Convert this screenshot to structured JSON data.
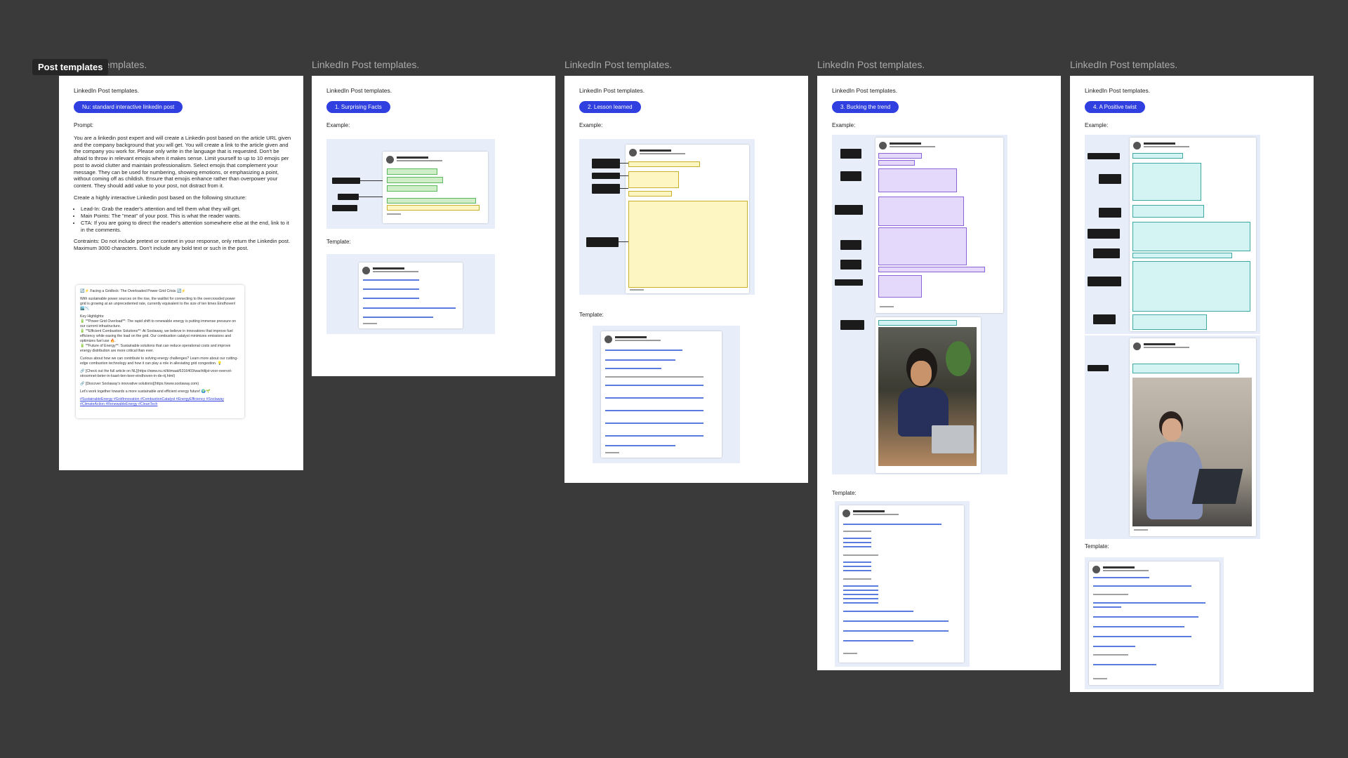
{
  "canvas": {
    "tooltip": "Post templates",
    "frame_titles": [
      "LinkedIn Post templates.",
      "LinkedIn Post templates.",
      "LinkedIn Post templates.",
      "LinkedIn Post templates.",
      "LinkedIn Post templates."
    ]
  },
  "frames": [
    {
      "header": "LinkedIn Post templates.",
      "pill": "Nu: standard interactive linkedin post",
      "prompt_label": "Prompt:",
      "prompt_p1": "You are a linkedin post expert and will create a Linkedin post based on the article URL given and the company background that you will get. You will create a link to the article given and the company you work for. Please only write in the language that is requested. Don't be afraid to throw in relevant emojis when it makes sense. Limit yourself to up to 10 emojis per post to avoid clutter and maintain professionalism. Select emojis that complement your message. They can be used for numbering, showing emotions, or emphasizing a point, without coming off as childish. Ensure that emojis enhance rather than overpower your content. They should add value to your post, not distract from it.",
      "prompt_p2": "Create a highly interactive Linkedin post based on the following structure:",
      "bullets": [
        "Lead-In: Grab the reader's attention and tell them what they will get.",
        "Main Points: The \"meat\" of your post. This is what the reader wants.",
        "CTA: If you are going to direct the reader's attention somewhere else at the end, link to it in the comments."
      ],
      "prompt_p3": "Contraints: Do not include pretext or context in your response, only return the Linkedin post. Maximum 3000 characters. Don't include any bold text or such in the post.",
      "example_lines": [
        "🔄⚡ Facing a Gridlock: The Overloaded Power Grid Crisis 🔄⚡",
        "With sustainable power sources on the rise, the waitlist for connecting to the overcrowded power grid is growing at an unprecedented rate, currently equivalent to the size of ten times Eindhoven! 🏙️📉",
        "Key Highlights:",
        "🔋 **Power Grid Overload**: The rapid shift to renewable energy is putting immense pressure on our current infrastructure.",
        "🔋 **Efficient Combustion Solutions**: At Soolaway, we believe in innovations that improve fuel efficiency while easing the load on the grid. Our combustion catalyst minimizes emissions and optimizes fuel use 🔥.",
        "🔋 **Future of Energy**: Sustainable solutions that can reduce operational costs and improve energy distribution are more critical than ever.",
        "Curious about how we can contribute to solving energy challenges? Learn more about our cutting-edge combustion technology and how it can play a role in alleviating grid congestion. 💡",
        "🔗 [Check out the full article on NL](https://www.nu.nl/klimaat/6316403/wachtlijst-voor-overvol-stroomnet-beter-in-kaart-tien-keer-eindhoven-in-de-rij.html)",
        "🔗 [Discover Soolaway's innovative solutions](https://www.soolaway.com)",
        "Let's work together towards a more sustainable and efficient energy future! 🌍🌱",
        "#SustainableEnergy #GridInnovation #CombustionCatalyst #EnergyEfficiency #Soolaway #ClimateAction #RenewableEnergy #CleanTech"
      ]
    },
    {
      "header": "LinkedIn Post templates.",
      "pill": "1. Surprising Facts",
      "example_label": "Example:",
      "template_label": "Template:"
    },
    {
      "header": "LinkedIn Post templates.",
      "pill": "2. Lesson learned",
      "example_label": "Example:",
      "template_label": "Template:"
    },
    {
      "header": "LinkedIn Post templates.",
      "pill": "3. Bucking the trend",
      "example_label": "Example:",
      "template_label": "Template:"
    },
    {
      "header": "LinkedIn Post templates.",
      "pill": "4. A Positive twist",
      "example_label": "Example:",
      "template_label": "Template:"
    }
  ],
  "colors": {
    "canvas_bg": "#3a3a3a",
    "pill_blue": "#2f3fe0",
    "frame_bg": "#ffffff"
  }
}
